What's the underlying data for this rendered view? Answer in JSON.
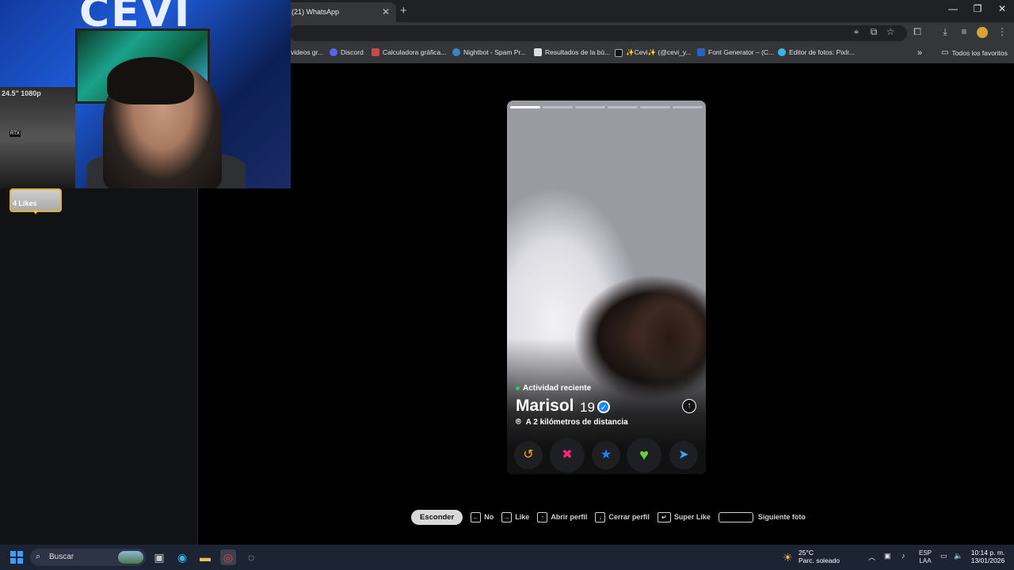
{
  "browser": {
    "tab_title": "(21) WhatsApp",
    "bookmarks": [
      {
        "label": "videos gr...",
        "color": "#4285f4"
      },
      {
        "label": "Discord",
        "color": "#5865f2"
      },
      {
        "label": "Calculadora gráfica...",
        "color": "#c94a4a"
      },
      {
        "label": "Nightbot - Spam Pr...",
        "color": "#3c82c4"
      },
      {
        "label": "Resultados de la bú...",
        "color": "#dddddd"
      },
      {
        "label": "✨Cevi✨ (@cevi_y...",
        "color": "#111111"
      },
      {
        "label": "Font Generator – (C...",
        "color": "#2d5fc4"
      },
      {
        "label": "Editor de fotos: Pixlr...",
        "color": "#3ab6e5"
      }
    ],
    "all_bookmarks": "Todos los favoritos"
  },
  "sidebar": {
    "likes_label": "4 Likes"
  },
  "webcam": {
    "logo": "CEVI",
    "monitor_label": "24.5\" 1080p",
    "rtx": "RTX"
  },
  "profile": {
    "activity": "Actividad reciente",
    "name": "Marisol",
    "age": "19",
    "distance": "A 2 kilómetros de distancia",
    "photo_count": 6,
    "current_photo": 1
  },
  "actions": {
    "rewind": "↺",
    "nope": "✖",
    "super_like": "★",
    "like": "♥",
    "boost": "➤"
  },
  "hints": {
    "hide": "Esconder",
    "no": "No",
    "like": "Like",
    "open_profile": "Abrir perfil",
    "close_profile": "Cerrar perfil",
    "super_like": "Super Like",
    "next_photo": "Siguiente foto"
  },
  "taskbar": {
    "search": "Buscar",
    "temp": "25°C",
    "weather": "Parc. soleado",
    "lang": "ESP",
    "lang2": "LAA",
    "time": "10:14 p. m.",
    "date": "13/01/2026"
  },
  "colors": {
    "accent_green": "#1ed760",
    "verified_blue": "#1786ff",
    "rewind": "#f5a623",
    "nope": "#fd267d",
    "super_like": "#1786ff",
    "like": "#6ad13d",
    "boost": "#3ba4ff"
  }
}
